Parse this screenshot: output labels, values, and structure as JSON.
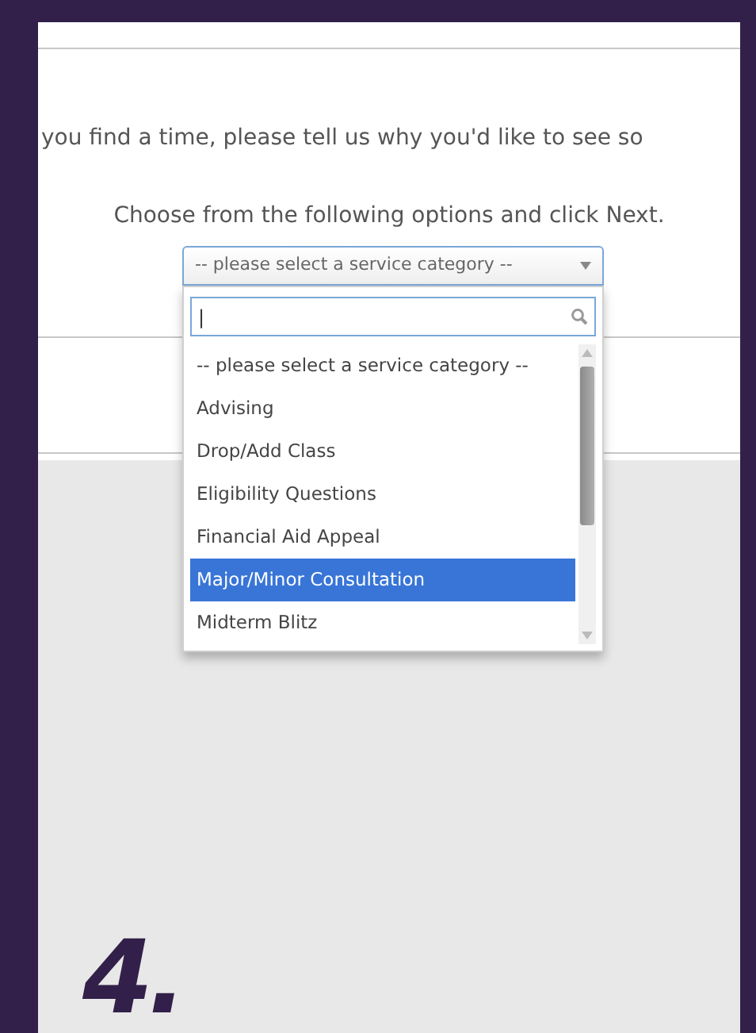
{
  "intro_text": "you find a time, please tell us why you'd like to see so",
  "instruction": "Choose from the following options and click Next.",
  "select": {
    "value": "-- please select a service category --",
    "expanded": true
  },
  "dropdown": {
    "search": {
      "value": "|"
    },
    "options": [
      {
        "label": "-- please select a service category --",
        "selected": false
      },
      {
        "label": "Advising",
        "selected": false
      },
      {
        "label": "Drop/Add Class",
        "selected": false
      },
      {
        "label": "Eligibility Questions",
        "selected": false
      },
      {
        "label": "Financial Aid Appeal",
        "selected": false
      },
      {
        "label": "Major/Minor Consultation",
        "selected": true
      },
      {
        "label": "Midterm Blitz",
        "selected": false
      }
    ]
  },
  "step_label": "4."
}
